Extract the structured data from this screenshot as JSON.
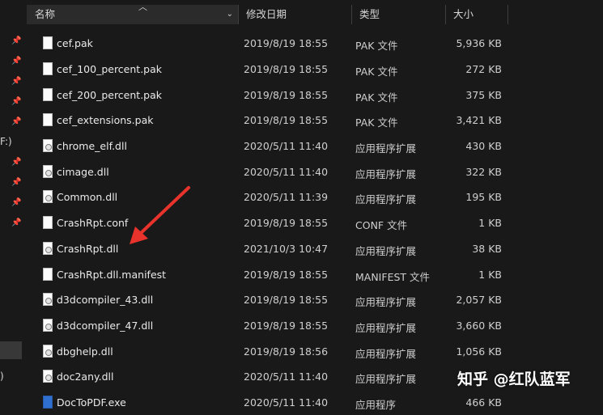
{
  "columns": {
    "name": "名称",
    "date": "修改日期",
    "type": "类型",
    "size": "大小"
  },
  "nav_fragments": [
    "F:)",
    ")"
  ],
  "files": [
    {
      "name": "cef.pak",
      "date": "2019/8/19 18:55",
      "type": "PAK 文件",
      "size": "5,936 KB",
      "icon": "file-icon"
    },
    {
      "name": "cef_100_percent.pak",
      "date": "2019/8/19 18:55",
      "type": "PAK 文件",
      "size": "272 KB",
      "icon": "file-icon"
    },
    {
      "name": "cef_200_percent.pak",
      "date": "2019/8/19 18:55",
      "type": "PAK 文件",
      "size": "375 KB",
      "icon": "file-icon"
    },
    {
      "name": "cef_extensions.pak",
      "date": "2019/8/19 18:55",
      "type": "PAK 文件",
      "size": "3,421 KB",
      "icon": "file-icon"
    },
    {
      "name": "chrome_elf.dll",
      "date": "2020/5/11 11:40",
      "type": "应用程序扩展",
      "size": "430 KB",
      "icon": "dll-icon"
    },
    {
      "name": "cimage.dll",
      "date": "2020/5/11 11:40",
      "type": "应用程序扩展",
      "size": "322 KB",
      "icon": "dll-icon"
    },
    {
      "name": "Common.dll",
      "date": "2020/5/11 11:39",
      "type": "应用程序扩展",
      "size": "195 KB",
      "icon": "dll-icon"
    },
    {
      "name": "CrashRpt.conf",
      "date": "2019/8/19 18:55",
      "type": "CONF 文件",
      "size": "1 KB",
      "icon": "file-icon"
    },
    {
      "name": "CrashRpt.dll",
      "date": "2021/10/3 10:47",
      "type": "应用程序扩展",
      "size": "38 KB",
      "icon": "dll-icon"
    },
    {
      "name": "CrashRpt.dll.manifest",
      "date": "2019/8/19 18:55",
      "type": "MANIFEST 文件",
      "size": "1 KB",
      "icon": "file-icon"
    },
    {
      "name": "d3dcompiler_43.dll",
      "date": "2019/8/19 18:55",
      "type": "应用程序扩展",
      "size": "2,057 KB",
      "icon": "dll-icon"
    },
    {
      "name": "d3dcompiler_47.dll",
      "date": "2019/8/19 18:55",
      "type": "应用程序扩展",
      "size": "3,660 KB",
      "icon": "dll-icon"
    },
    {
      "name": "dbghelp.dll",
      "date": "2019/8/19 18:56",
      "type": "应用程序扩展",
      "size": "1,056 KB",
      "icon": "dll-icon"
    },
    {
      "name": "doc2any.dll",
      "date": "2020/5/11 11:40",
      "type": "应用程序扩展",
      "size": "",
      "icon": "dll-icon"
    },
    {
      "name": "DocToPDF.exe",
      "date": "2020/5/11 11:40",
      "type": "应用程序",
      "size": "466 KB",
      "icon": "exe-icon"
    }
  ],
  "watermark": "知乎 @红队蓝军",
  "colors": {
    "background": "#191919",
    "header_selected": "#2b2b2b",
    "annotation_arrow": "#e8332c"
  }
}
